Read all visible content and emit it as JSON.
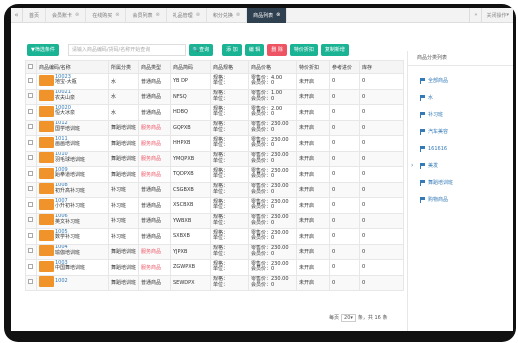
{
  "tabs": [
    {
      "label": "首页",
      "active": false
    },
    {
      "label": "会员账卡",
      "active": false
    },
    {
      "label": "在线购买",
      "active": false
    },
    {
      "label": "会员列表",
      "active": false
    },
    {
      "label": "礼品管理",
      "active": false
    },
    {
      "label": "积分兑换",
      "active": false
    },
    {
      "label": "商品列表",
      "active": true
    }
  ],
  "tab_right": {
    "more": "关闭操作"
  },
  "toolbar": {
    "filter": "筛选条件",
    "search_placeholder": "请输入商品编码/货码/名称开始查询",
    "search": "查询",
    "add": "添 加",
    "edit": "编 辑",
    "delete": "删 除",
    "discount": "特价折扣",
    "copy": "复制新增"
  },
  "table": {
    "headers": [
      "商品编码/名称",
      "所属分类",
      "商品类型",
      "商品简码",
      "商品规格",
      "商品价格",
      "特价折扣",
      "参考进价",
      "库存"
    ],
    "rows": [
      {
        "code": "10023",
        "name": "地宝-大瓶",
        "category": "水",
        "type": "普通商品",
        "short": "YB DP",
        "spec1": "规格：",
        "spec2": "单位：",
        "price1": "零售价：4.00",
        "price2": "会员价：0",
        "discount": "未开启",
        "cost": "0",
        "stock": "0",
        "service": false
      },
      {
        "code": "10021",
        "name": "农夫山泉",
        "category": "水",
        "type": "普通商品",
        "short": "NFSQ",
        "spec1": "规格：",
        "spec2": "单位：",
        "price1": "零售价：1.00",
        "price2": "会员价：0",
        "discount": "未开启",
        "cost": "0",
        "stock": "0",
        "service": false
      },
      {
        "code": "10020",
        "name": "恒大冰泉",
        "category": "水",
        "type": "普通商品",
        "short": "HDBQ",
        "spec1": "规格：",
        "spec2": "单位：",
        "price1": "零售价：2.00",
        "price2": "会员价：0",
        "discount": "未开启",
        "cost": "0",
        "stock": "0",
        "service": false
      },
      {
        "code": "1012",
        "name": "国学培训班",
        "category": "舞蹈培训班",
        "type": "服务商品",
        "short": "GQPXB",
        "spec1": "规格：",
        "spec2": "单位：",
        "price1": "零售价：230.00",
        "price2": "会员价：0",
        "discount": "未开启",
        "cost": "0",
        "stock": "0",
        "service": true
      },
      {
        "code": "1011",
        "name": "画画培训班",
        "category": "舞蹈培训班",
        "type": "服务商品",
        "short": "HHPXB",
        "spec1": "规格：",
        "spec2": "单位：",
        "price1": "零售价：230.00",
        "price2": "会员价：0",
        "discount": "未开启",
        "cost": "0",
        "stock": "0",
        "service": true
      },
      {
        "code": "1010",
        "name": "羽毛球培训班",
        "category": "舞蹈培训班",
        "type": "服务商品",
        "short": "YMQPXB",
        "spec1": "规格：",
        "spec2": "单位：",
        "price1": "零售价：230.00",
        "price2": "会员价：0",
        "discount": "未开启",
        "cost": "0",
        "stock": "0",
        "service": true
      },
      {
        "code": "1009",
        "name": "跆拳道培训班",
        "category": "舞蹈培训班",
        "type": "服务商品",
        "short": "TQDPXB",
        "spec1": "规格：",
        "spec2": "单位：",
        "price1": "零售价：230.00",
        "price2": "会员价：0",
        "discount": "未开启",
        "cost": "0",
        "stock": "0",
        "service": true
      },
      {
        "code": "1008",
        "name": "初升高补习班",
        "category": "补习班",
        "type": "普通商品",
        "short": "CSGBXB",
        "spec1": "规格：",
        "spec2": "单位：",
        "price1": "零售价：230.00",
        "price2": "会员价：0",
        "discount": "未开启",
        "cost": "0",
        "stock": "0",
        "service": false
      },
      {
        "code": "1007",
        "name": "小升初补习班",
        "category": "补习班",
        "type": "普通商品",
        "short": "XSCBXB",
        "spec1": "规格：",
        "spec2": "单位：",
        "price1": "零售价：230.00",
        "price2": "会员价：0",
        "discount": "未开启",
        "cost": "0",
        "stock": "0",
        "service": false
      },
      {
        "code": "1006",
        "name": "英文补习班",
        "category": "补习班",
        "type": "普通商品",
        "short": "YWBXB",
        "spec1": "规格：",
        "spec2": "单位：",
        "price1": "零售价：230.00",
        "price2": "会员价：0",
        "discount": "未开启",
        "cost": "0",
        "stock": "0",
        "service": false
      },
      {
        "code": "1005",
        "name": "数学补习班",
        "category": "补习班",
        "type": "普通商品",
        "short": "SXBXB",
        "spec1": "规格：",
        "spec2": "单位：",
        "price1": "零售价：230.00",
        "price2": "会员价：0",
        "discount": "未开启",
        "cost": "0",
        "stock": "0",
        "service": false
      },
      {
        "code": "1004",
        "name": "瑜伽培训班",
        "category": "舞蹈培训班",
        "type": "服务商品",
        "short": "YJPXB",
        "spec1": "规格：",
        "spec2": "单位：",
        "price1": "零售价：230.00",
        "price2": "会员价：0",
        "discount": "未开启",
        "cost": "0",
        "stock": "0",
        "service": true
      },
      {
        "code": "1003",
        "name": "中国舞培训班",
        "category": "舞蹈培训班",
        "type": "服务商品",
        "short": "ZGWPXB",
        "spec1": "规格：",
        "spec2": "单位：",
        "price1": "零售价：230.00",
        "price2": "会员价：0",
        "discount": "未开启",
        "cost": "0",
        "stock": "0",
        "service": true
      },
      {
        "code": "1002",
        "name": "",
        "category": "舞蹈培训班",
        "type": "普通商品",
        "short": "SEWDPX",
        "spec1": "规格：",
        "spec2": "单位：",
        "price1": "零售价：230.00",
        "price2": "会员价：0",
        "discount": "未开启",
        "cost": "0",
        "stock": "0",
        "service": false
      }
    ]
  },
  "pager": {
    "prefix": "每页",
    "size": "20",
    "suffix": "条，共 16 条"
  },
  "right_panel": {
    "title": "商品分类列表",
    "items": [
      {
        "label": "全部商品",
        "selected": false
      },
      {
        "label": "水",
        "selected": false
      },
      {
        "label": "补习班",
        "selected": false
      },
      {
        "label": "汽车美容",
        "selected": false
      },
      {
        "label": "161616",
        "selected": false
      },
      {
        "label": "美发",
        "selected": true
      },
      {
        "label": "舞蹈培训班",
        "selected": false
      },
      {
        "label": "购物商品",
        "selected": false
      }
    ]
  },
  "colors": {
    "accent_teal": "#1ab394",
    "accent_blue": "#1c84c6",
    "danger": "#ed5565",
    "active_tab": "#2f4050",
    "thumb": "#f0932b"
  }
}
